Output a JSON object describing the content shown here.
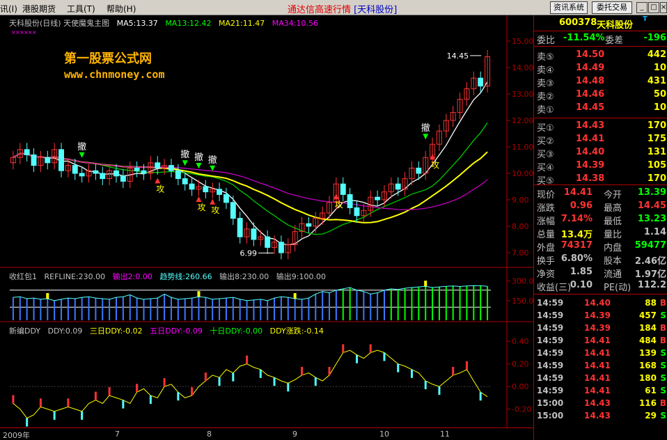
{
  "menubar": {
    "items": [
      "讯(I)",
      "港股期货",
      "工具(T)",
      "帮助(H)"
    ],
    "app_title": "通达信高速行情",
    "stock_tag": "[天科股份]",
    "btn_news": "资讯系统",
    "btn_trade": "委托交易"
  },
  "colors": {
    "up": "#ff3232",
    "down": "#54ffff",
    "white": "#ffffff",
    "yellow": "#ffff00",
    "green": "#00c800",
    "magenta": "#ff00ff",
    "grid": "#b00000",
    "label": "#c0c0c0"
  },
  "main_panel": {
    "title": "天科股份(日线) 天使魔鬼主图",
    "ma5": "MA5:13.37",
    "ma13": "MA13:12.42",
    "ma21": "MA21:11.47",
    "ma34": "MA34:10.56",
    "watermark_cn": "第一股票公式网",
    "watermark_url": "www.chnmoney.com",
    "max_label": "14.45",
    "min_label": "6.99",
    "axis_ticks": [
      "15.00",
      "14.00",
      "13.00",
      "12.00",
      "11.00",
      "10.00",
      "9.00",
      "8.00",
      "7.00"
    ],
    "sell_label": "撤",
    "buy_label": "攻",
    "x_labels": [
      "2009年",
      "7",
      "8",
      "9",
      "10",
      "11"
    ]
  },
  "mid_panel": {
    "name": "收红包1",
    "refline": "REFLINE:230.00",
    "out2": "输出2:0.00",
    "trend": "趋势线:260.66",
    "out8": "输出8:230.00",
    "out9": "输出9:100.00",
    "axis_ticks": [
      "300.0",
      "150.0"
    ]
  },
  "ddy_panel": {
    "name": "新编DDY",
    "ddy": "DDY:0.09",
    "d3": "三日DDY:-0.02",
    "d5": "五日DDY:-0.09",
    "d10": "十日DDY:-0.00",
    "dz": "DDY涨跌:-0.14",
    "axis_ticks": [
      "0.40",
      "0.20",
      "0.00",
      "-0.20"
    ]
  },
  "quote": {
    "code": "600378",
    "name": "天科股份",
    "t_badge": "T",
    "wei_bi_label": "委比",
    "wei_bi": "-11.54%",
    "wei_cha_label": "委差",
    "wei_cha": "-196",
    "asks": [
      {
        "label": "卖⑤",
        "price": "14.50",
        "vol": "442"
      },
      {
        "label": "卖④",
        "price": "14.49",
        "vol": "10"
      },
      {
        "label": "卖③",
        "price": "14.48",
        "vol": "431"
      },
      {
        "label": "卖②",
        "price": "14.46",
        "vol": "50"
      },
      {
        "label": "卖①",
        "price": "14.45",
        "vol": "10"
      }
    ],
    "bids": [
      {
        "label": "买①",
        "price": "14.43",
        "vol": "170"
      },
      {
        "label": "买②",
        "price": "14.41",
        "vol": "175"
      },
      {
        "label": "买③",
        "price": "14.40",
        "vol": "131"
      },
      {
        "label": "买④",
        "price": "14.39",
        "vol": "105"
      },
      {
        "label": "买⑤",
        "price": "14.38",
        "vol": "170"
      }
    ],
    "stats": [
      {
        "l1": "现价",
        "v1": "14.41",
        "l2": "今开",
        "v2": "13.39"
      },
      {
        "l1": "涨跌",
        "v1": "0.96",
        "l2": "最高",
        "v2": "14.45"
      },
      {
        "l1": "涨幅",
        "v1": "7.14%",
        "l2": "最低",
        "v2": "13.23"
      },
      {
        "l1": "总量",
        "v1": "13.4万",
        "l2": "量比",
        "v2": "1.14"
      },
      {
        "l1": "外盘",
        "v1": "74317",
        "l2": "内盘",
        "v2": "59477"
      },
      {
        "l1": "换手",
        "v1": "6.80%",
        "l2": "股本",
        "v2": "2.46亿"
      },
      {
        "l1": "净资",
        "v1": "1.85",
        "l2": "流通",
        "v2": "1.97亿"
      },
      {
        "l1": "收益(三)",
        "v1": "0.10",
        "l2": "PE(动)",
        "v2": "112.2"
      }
    ],
    "ticks": [
      {
        "time": "14:59",
        "price": "14.40",
        "vol": "88",
        "bs": "B"
      },
      {
        "time": "14:59",
        "price": "14.39",
        "vol": "457",
        "bs": "S"
      },
      {
        "time": "14:59",
        "price": "14.39",
        "vol": "184",
        "bs": "B"
      },
      {
        "time": "14:59",
        "price": "14.41",
        "vol": "484",
        "bs": "B"
      },
      {
        "time": "14:59",
        "price": "14.41",
        "vol": "139",
        "bs": "S"
      },
      {
        "time": "14:59",
        "price": "14.41",
        "vol": "168",
        "bs": "S"
      },
      {
        "time": "14:59",
        "price": "14.41",
        "vol": "180",
        "bs": "S"
      },
      {
        "time": "14:59",
        "price": "14.41",
        "vol": "61",
        "bs": "S"
      },
      {
        "time": "15:00",
        "price": "14.43",
        "vol": "116",
        "bs": "B"
      },
      {
        "time": "15:00",
        "price": "14.43",
        "vol": "29",
        "bs": "S"
      }
    ]
  },
  "chart_data": {
    "type": "candlestick",
    "title": "天科股份(日线) 天使魔鬼主图",
    "y_range": [
      6.5,
      15.5
    ],
    "close": [
      10.6,
      10.9,
      10.7,
      10.3,
      10.6,
      10.4,
      10.9,
      10.1,
      10.3,
      10.0,
      9.9,
      10.1,
      10.0,
      9.8,
      10.1,
      9.9,
      9.7,
      10.2,
      10.1,
      10.0,
      10.4,
      10.2,
      10.3,
      10.1,
      9.8,
      9.6,
      9.4,
      9.5,
      9.3,
      9.4,
      9.2,
      8.9,
      8.3,
      7.6,
      7.9,
      7.5,
      7.6,
      7.2,
      7.4,
      7.0,
      7.3,
      7.8,
      8.1,
      8.0,
      8.3,
      8.5,
      8.9,
      9.6,
      9.2,
      8.7,
      8.4,
      8.6,
      9.1,
      9.0,
      9.3,
      9.6,
      9.4,
      9.8,
      10.2,
      10.0,
      10.6,
      11.1,
      11.6,
      12.0,
      12.3,
      12.8,
      13.2,
      13.6,
      13.3,
      14.41
    ],
    "markers_sell": [
      {
        "i": 10
      },
      {
        "i": 25
      },
      {
        "i": 27
      },
      {
        "i": 29
      },
      {
        "i": 60
      }
    ],
    "markers_buy": [
      {
        "i": 21
      },
      {
        "i": 27
      },
      {
        "i": 29
      },
      {
        "i": 47
      },
      {
        "i": 61
      }
    ],
    "ddy": [
      -0.15,
      -0.2,
      -0.28,
      -0.25,
      -0.18,
      -0.2,
      -0.22,
      -0.2,
      -0.18,
      -0.2,
      -0.22,
      -0.15,
      -0.12,
      -0.15,
      -0.08,
      -0.1,
      -0.12,
      -0.15,
      -0.05,
      -0.02,
      -0.08,
      -0.1,
      0.0,
      0.02,
      -0.05,
      -0.1,
      -0.08,
      0.0,
      0.05,
      0.1,
      0.08,
      0.15,
      0.12,
      0.18,
      0.2,
      0.17,
      0.15,
      0.1,
      0.08,
      0.05,
      0.03,
      0.06,
      0.1,
      0.12,
      0.08,
      0.05,
      0.1,
      0.2,
      0.3,
      0.32,
      0.28,
      0.25,
      0.3,
      0.32,
      0.3,
      0.25,
      0.2,
      0.18,
      0.15,
      0.12,
      0.05,
      0.02,
      0.0,
      0.05,
      0.1,
      0.12,
      0.15,
      0.05,
      -0.05,
      -0.09
    ],
    "hb": [
      175,
      180,
      165,
      170,
      160,
      165,
      150,
      160,
      170,
      165,
      175,
      180,
      170,
      165,
      160,
      175,
      180,
      195,
      170,
      160,
      165,
      170,
      200,
      175,
      160,
      165,
      170,
      180,
      175,
      160,
      165,
      170,
      175,
      160,
      150,
      155,
      160,
      150,
      170,
      180,
      175,
      165,
      160,
      170,
      200,
      220,
      210,
      230,
      240,
      250,
      230,
      220,
      200,
      210,
      230,
      240,
      235,
      245,
      250,
      255,
      260,
      250,
      255,
      260,
      262,
      258,
      262,
      265,
      264,
      260
    ]
  }
}
